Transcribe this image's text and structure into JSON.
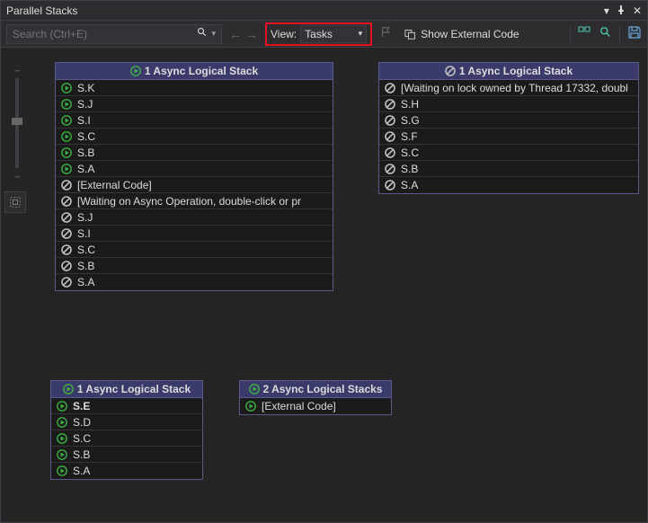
{
  "titlebar": {
    "title": "Parallel Stacks"
  },
  "toolbar": {
    "search_placeholder": "Search (Ctrl+E)",
    "view_label": "View:",
    "view_value": "Tasks",
    "show_external": "Show External Code"
  },
  "stacks": {
    "a": {
      "header": "1 Async Logical Stack",
      "header_icon": "play",
      "rows": [
        {
          "icon": "play",
          "label": "S.K"
        },
        {
          "icon": "play",
          "label": "S.J"
        },
        {
          "icon": "play",
          "label": "S.I"
        },
        {
          "icon": "play",
          "label": "S.C"
        },
        {
          "icon": "play",
          "label": "S.B"
        },
        {
          "icon": "play",
          "label": "S.A"
        },
        {
          "icon": "no",
          "label": "[External Code]"
        },
        {
          "icon": "no",
          "label": "[Waiting on Async Operation, double-click or pr"
        },
        {
          "icon": "no",
          "label": "S.J"
        },
        {
          "icon": "no",
          "label": "S.I"
        },
        {
          "icon": "no",
          "label": "S.C"
        },
        {
          "icon": "no",
          "label": "S.B"
        },
        {
          "icon": "no",
          "label": "S.A"
        }
      ]
    },
    "b": {
      "header": "1 Async Logical Stack",
      "header_icon": "no",
      "rows": [
        {
          "icon": "no",
          "label": "[Waiting on lock owned by Thread 17332, doubl"
        },
        {
          "icon": "no",
          "label": "S.H"
        },
        {
          "icon": "no",
          "label": "S.G"
        },
        {
          "icon": "no",
          "label": "S.F"
        },
        {
          "icon": "no",
          "label": "S.C"
        },
        {
          "icon": "no",
          "label": "S.B"
        },
        {
          "icon": "no",
          "label": "S.A"
        }
      ]
    },
    "c": {
      "header": "1 Async Logical Stack",
      "header_icon": "play",
      "rows": [
        {
          "icon": "play",
          "label": "S.E",
          "bold": true
        },
        {
          "icon": "play",
          "label": "S.D"
        },
        {
          "icon": "play",
          "label": "S.C"
        },
        {
          "icon": "play",
          "label": "S.B"
        },
        {
          "icon": "play",
          "label": "S.A"
        }
      ]
    },
    "d": {
      "header": "2 Async Logical Stacks",
      "header_icon": "play",
      "rows": [
        {
          "icon": "play",
          "label": "[External Code]"
        }
      ]
    }
  }
}
